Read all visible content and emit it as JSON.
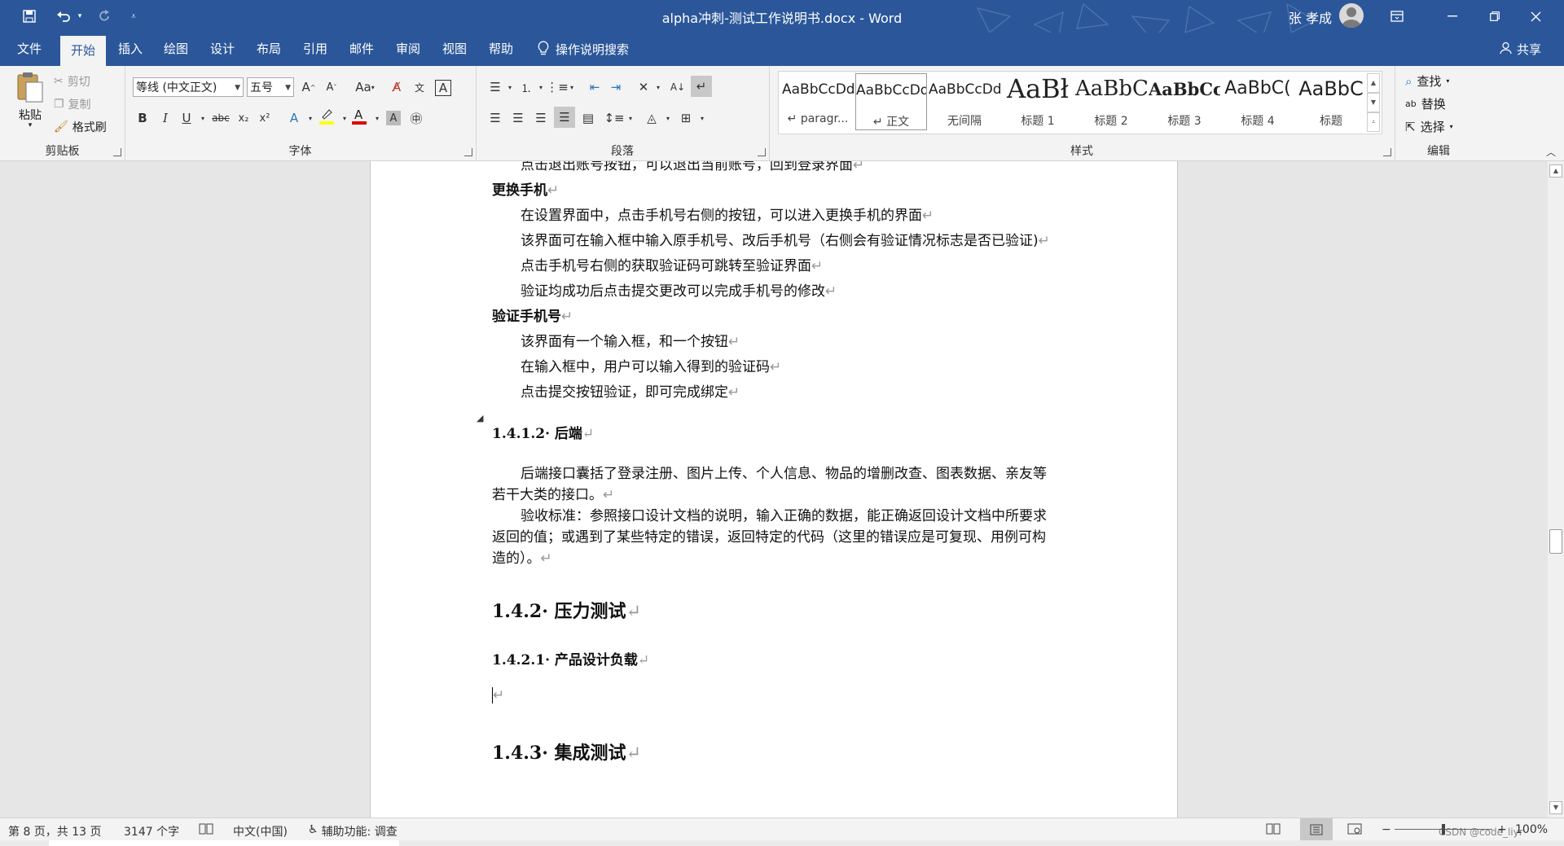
{
  "titlebar": {
    "doc_title": "alpha冲刺-测试工作说明书.docx - Word",
    "user_name": "张 孝成",
    "bg": "#2b579a"
  },
  "tabs": [
    {
      "label": "文件"
    },
    {
      "label": "开始",
      "active": true
    },
    {
      "label": "插入"
    },
    {
      "label": "绘图"
    },
    {
      "label": "设计"
    },
    {
      "label": "布局"
    },
    {
      "label": "引用"
    },
    {
      "label": "邮件"
    },
    {
      "label": "审阅"
    },
    {
      "label": "视图"
    },
    {
      "label": "帮助"
    }
  ],
  "tell_me": "操作说明搜索",
  "share": "共享",
  "clipboard": {
    "paste": "粘贴",
    "cut": "剪切",
    "copy": "复制",
    "format_painter": "格式刷",
    "label": "剪贴板"
  },
  "font": {
    "name": "等线 (中文正文)",
    "size": "五号",
    "label": "字体"
  },
  "paragraph": {
    "label": "段落"
  },
  "styles": {
    "label": "样式",
    "items": [
      {
        "preview": "AaBbCcDd",
        "name": "↵ paragr..."
      },
      {
        "preview": "AaBbCcDd",
        "name": "↵ 正文"
      },
      {
        "preview": "AaBbCcDd",
        "name": "无间隔"
      },
      {
        "preview": "AaBł",
        "name": "标题 1"
      },
      {
        "preview": "AaBbC",
        "name": "标题 2"
      },
      {
        "preview": "AaBbCc",
        "name": "标题 3"
      },
      {
        "preview": "AaBbC(",
        "name": "标题 4"
      },
      {
        "preview": "AaBbC",
        "name": "标题"
      }
    ]
  },
  "editing": {
    "find": "查找",
    "replace": "替换",
    "select": "选择",
    "label": "编辑"
  },
  "document": {
    "line_partial": "点击退出账号按钮，可以退出当前账号，回到登录界面",
    "h_change_phone": "更换手机",
    "change_phone_lines": [
      "在设置界面中，点击手机号右侧的按钮，可以进入更换手机的界面",
      "该界面可在输入框中输入原手机号、改后手机号（右侧会有验证情况标志是否已验证)",
      "点击手机号右侧的获取验证码可跳转至验证界面",
      "验证均成功后点击提交更改可以完成手机号的修改"
    ],
    "h_verify_phone": "验证手机号",
    "verify_lines": [
      "该界面有一个输入框，和一个按钮",
      "在输入框中，用户可以输入得到的验证码",
      "点击提交按钮验证，即可完成绑定"
    ],
    "h_backend": "1.4.1.2· 后端",
    "backend_p1_l1": "后端接口囊括了登录注册、图片上传、个人信息、物品的增删改查、图表数据、亲友等",
    "backend_p1_l2": "若干大类的接口。",
    "backend_p2_l1": "验收标准：参照接口设计文档的说明，输入正确的数据，能正确返回设计文档中所要求",
    "backend_p2_l2": "返回的值；或遇到了某些特定的错误，返回特定的代码（这里的错误应是可复现、用例可构",
    "backend_p2_l3": "造的）。",
    "h_stress": "1.4.2· 压力测试",
    "h_load": "1.4.2.1· 产品设计负载",
    "h_integration": "1.4.3· 集成测试",
    "para_mark": "↵"
  },
  "status": {
    "page": "第 8 页，共 13 页",
    "words": "3147 个字",
    "language": "中文(中国)",
    "accessibility": "辅助功能: 调查",
    "zoom": "100%",
    "watermark": "CSDN @code_liyr"
  }
}
